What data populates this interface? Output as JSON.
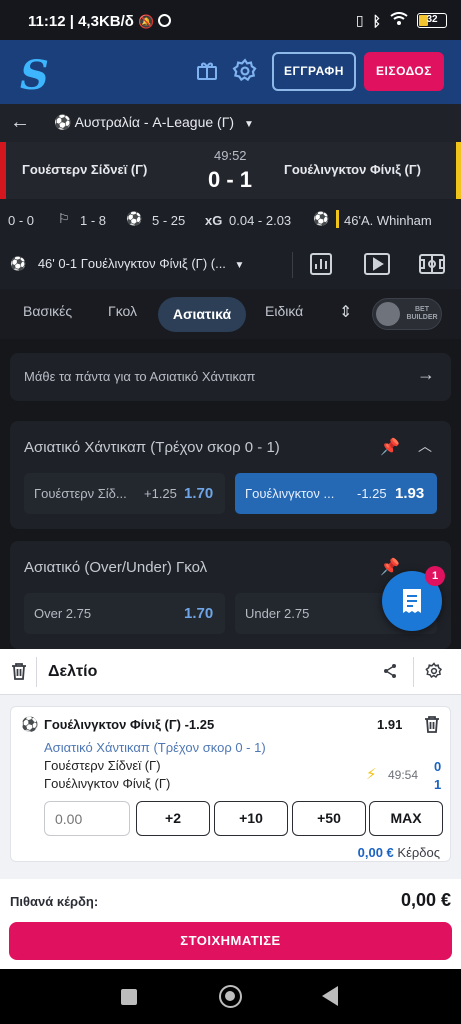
{
  "status_bar": {
    "time": "11:12",
    "network": "4,3KB/δ",
    "battery": "32"
  },
  "header": {
    "register": "ΕΓΓΡΑΦΗ",
    "login": "ΕΙΣΟΔΟΣ"
  },
  "match": {
    "league": "Αυστραλία - A-League (Γ)",
    "home": "Γουέστερν Σίδνεϊ (Γ)",
    "away": "Γουέλινγκτον Φίνιξ (Γ)",
    "clock": "49:52",
    "score": "0 - 1"
  },
  "stats": {
    "s1": "0 - 0",
    "s2": "1 - 8",
    "s3": "5 - 25",
    "xg_label": "xG",
    "xg": "0.04 - 2.03",
    "event": "46'A. Whinham"
  },
  "event_row": {
    "text": "46'   0-1 Γουέλινγκτον Φίνιξ (Γ) (..."
  },
  "tabs": [
    "Βασικές",
    "Γκολ",
    "Ασιατικά",
    "Ειδικά"
  ],
  "bet_builder": "BET BUILDER",
  "learn": "Μάθε τα πάντα για το Ασιατικό Χάντικαπ",
  "market1": {
    "title": "Ασιατικό Χάντικαπ (Τρέχον σκορ 0 - 1)",
    "home_name": "Γουέστερν Σίδ...",
    "home_line": "+1.25",
    "home_odds": "1.70",
    "away_name": "Γουέλινγκτον ...",
    "away_line": "-1.25",
    "away_odds": "1.93"
  },
  "market2": {
    "title": "Ασιατικό (Over/Under) Γκολ",
    "over": "Over 2.75",
    "over_odds": "1.70",
    "under": "Under 2.75"
  },
  "fab_badge": "1",
  "slip": {
    "title": "Δελτίο",
    "selection": "Γουέλινγκτον Φίνιξ (Γ) -1.25",
    "odds": "1.91",
    "market": "Ασιατικό Χάντικαπ (Τρέχον σκορ 0 - 1)",
    "home": "Γουέστερν Σίδνεϊ (Γ)",
    "away": "Γουέλινγκτον Φίνιξ (Γ)",
    "clock": "49:54",
    "home_score": "0",
    "away_score": "1",
    "stake_placeholder": "0.00",
    "quick": [
      "+2",
      "+10",
      "+50",
      "MAX"
    ],
    "profit_amount": "0,00 €",
    "profit_label": "Κέρδος"
  },
  "payout": {
    "label": "Πιθανά κέρδη:",
    "amount": "0,00 €",
    "cta": "ΣΤΟΙΧΗΜΑΤΙΣΕ"
  },
  "colors": {
    "accent": "#e0115e",
    "primary": "#1b78d6",
    "header": "#1b3f7a"
  }
}
